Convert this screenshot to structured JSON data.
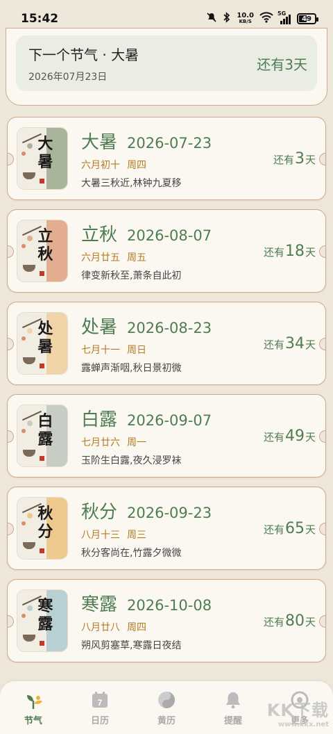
{
  "status": {
    "time": "15:42",
    "net_speed_value": "10.0",
    "net_speed_unit": "KB/S",
    "network": "5G",
    "battery": "49",
    "battery_level": 0.49
  },
  "next_term": {
    "title": "下一个节气 · 大暑",
    "date": "2026年07月23日",
    "remaining": "还有3天"
  },
  "terms": [
    {
      "name": "大暑",
      "date": "2026-07-23",
      "lunar": "六月初十",
      "weekday": "周四",
      "poem": "大暑三秋近,林钟九夏移",
      "prefix": "还有",
      "days": "3",
      "suffix": "天",
      "calligraphy": "大暑",
      "accent": "#a9b59a"
    },
    {
      "name": "立秋",
      "date": "2026-08-07",
      "lunar": "六月廿五",
      "weekday": "周五",
      "poem": "律变新秋至,萧条自此初",
      "prefix": "还有",
      "days": "18",
      "suffix": "天",
      "calligraphy": "立秋",
      "accent": "#e3ad8f"
    },
    {
      "name": "处暑",
      "date": "2026-08-23",
      "lunar": "七月十一",
      "weekday": "周日",
      "poem": "露蝉声渐咽,秋日景初微",
      "prefix": "还有",
      "days": "34",
      "suffix": "天",
      "calligraphy": "处暑",
      "accent": "#f0d4a8"
    },
    {
      "name": "白露",
      "date": "2026-09-07",
      "lunar": "七月廿六",
      "weekday": "周一",
      "poem": "玉阶生白露,夜久浸罗袜",
      "prefix": "还有",
      "days": "49",
      "suffix": "天",
      "calligraphy": "白露",
      "accent": "#c7ccc5"
    },
    {
      "name": "秋分",
      "date": "2026-09-23",
      "lunar": "八月十三",
      "weekday": "周三",
      "poem": "秋分客尚在,竹露夕微微",
      "prefix": "还有",
      "days": "65",
      "suffix": "天",
      "calligraphy": "秋分",
      "accent": "#edc98e"
    },
    {
      "name": "寒露",
      "date": "2026-10-08",
      "lunar": "八月廿八",
      "weekday": "周四",
      "poem": "朔风剪塞草,寒露日夜结",
      "prefix": "还有",
      "days": "80",
      "suffix": "天",
      "calligraphy": "寒露",
      "accent": "#b8cfd4"
    }
  ],
  "nav": {
    "items": [
      {
        "label": "节气",
        "icon": "sprout-bird-icon"
      },
      {
        "label": "日历",
        "icon": "calendar-icon"
      },
      {
        "label": "黄历",
        "icon": "yin-yang-icon"
      },
      {
        "label": "提醒",
        "icon": "bell-icon"
      },
      {
        "label": "更多",
        "icon": "more-icon"
      }
    ],
    "calendar_day": "7"
  },
  "watermark": {
    "brand": "KK下载",
    "url": "www.kkx.net"
  },
  "colors": {
    "accent_green": "#4e7d52",
    "lunar_orange": "#b47b25",
    "card_border": "#cda98a",
    "page_bg": "#efe7da"
  }
}
